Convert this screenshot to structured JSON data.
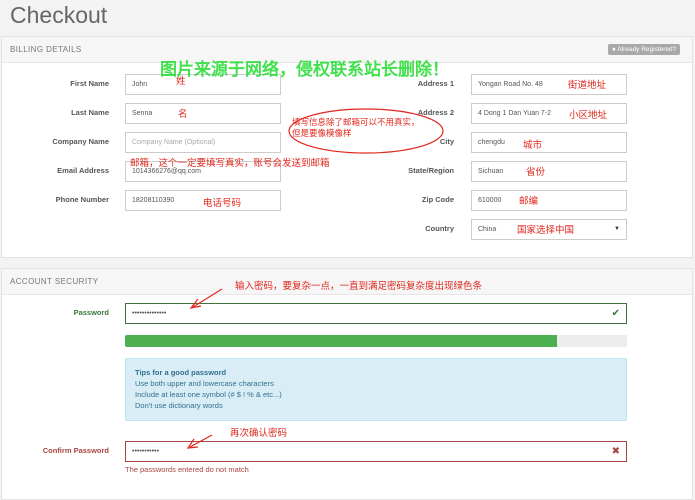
{
  "page": {
    "title": "Checkout"
  },
  "billing": {
    "header": "BILLING DETAILS",
    "badge": "Already Registered?",
    "fields": {
      "first_name": {
        "label": "First Name",
        "value": "John"
      },
      "last_name": {
        "label": "Last Name",
        "value": "Senna"
      },
      "company": {
        "label": "Company Name",
        "placeholder": "Company Name (Optional)"
      },
      "email": {
        "label": "Email Address",
        "value": "1014366276@qq.com"
      },
      "phone": {
        "label": "Phone Number",
        "value": "18208110390"
      },
      "address1": {
        "label": "Address 1",
        "value": "Yongan Road No. 48"
      },
      "address2": {
        "label": "Address 2",
        "value": "4 Dong 1 Dan Yuan 7-2"
      },
      "city": {
        "label": "City",
        "value": "chengdu"
      },
      "state": {
        "label": "State/Region",
        "value": "Sichuan"
      },
      "zip": {
        "label": "Zip Code",
        "value": "610000"
      },
      "country": {
        "label": "Country",
        "value": "China"
      }
    }
  },
  "security": {
    "header": "ACCOUNT SECURITY",
    "password": {
      "label": "Password",
      "value": "••••••••••••••"
    },
    "strength": 0.86,
    "tips": {
      "title": "Tips for a good password",
      "line1": "Use both upper and lowercase characters",
      "line2": "Include at least one symbol (# $ ! % & etc...)",
      "line3": "Don't use dictionary words"
    },
    "confirm": {
      "label": "Confirm Password",
      "value": "•••••••••••",
      "error": "The passwords entered do not match"
    }
  },
  "annotations": {
    "watermark": "图片来源于网络，侵权联系站长删除！",
    "first_name": "姓",
    "last_name": "名",
    "address1": "街道地址",
    "address2": "小区地址",
    "city": "城市",
    "state": "省份",
    "zip": "邮编",
    "country": "国家选择中国",
    "phone": "电话号码",
    "email": "邮箱，这个一定要填写真实，账号会发送到邮箱",
    "oval_line1": "填写信息除了邮箱可以不用真实，",
    "oval_line2": "但是要像模像样",
    "password": "输入密码，要复杂一点，一直到满足密码复杂度出现绿色条",
    "confirm": "再次确认密码"
  },
  "colors": {
    "success": "#4caf50",
    "error": "#a94442",
    "annotation": "#e0261b",
    "watermark": "#2dde3a"
  },
  "icons": {
    "password_ok": "check-icon",
    "confirm_err": "cross-icon",
    "country_select": "caret-down-icon"
  }
}
